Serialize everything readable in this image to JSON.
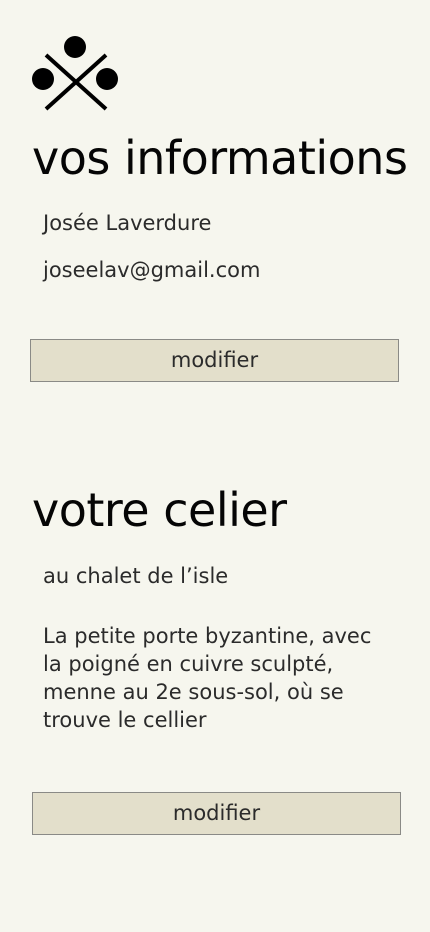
{
  "logo": {
    "icon": "crossed-dots-logo-icon"
  },
  "info": {
    "title": "vos informations",
    "name": "Josée Laverdure",
    "email": "joseelav@gmail.com",
    "modify_label": "modifier"
  },
  "cellar": {
    "title": "votre celier",
    "location": "au chalet de l’isle",
    "description": "La petite porte byzantine, avec la poigné en cuivre sculpté, menne au 2e sous-sol, où se trouve le cellier",
    "modify_label": "modifier"
  },
  "colors": {
    "background": "#f6f6ee",
    "button_background": "#e3dfcb",
    "button_border": "#8a8a86",
    "text": "#2b2b2b"
  }
}
